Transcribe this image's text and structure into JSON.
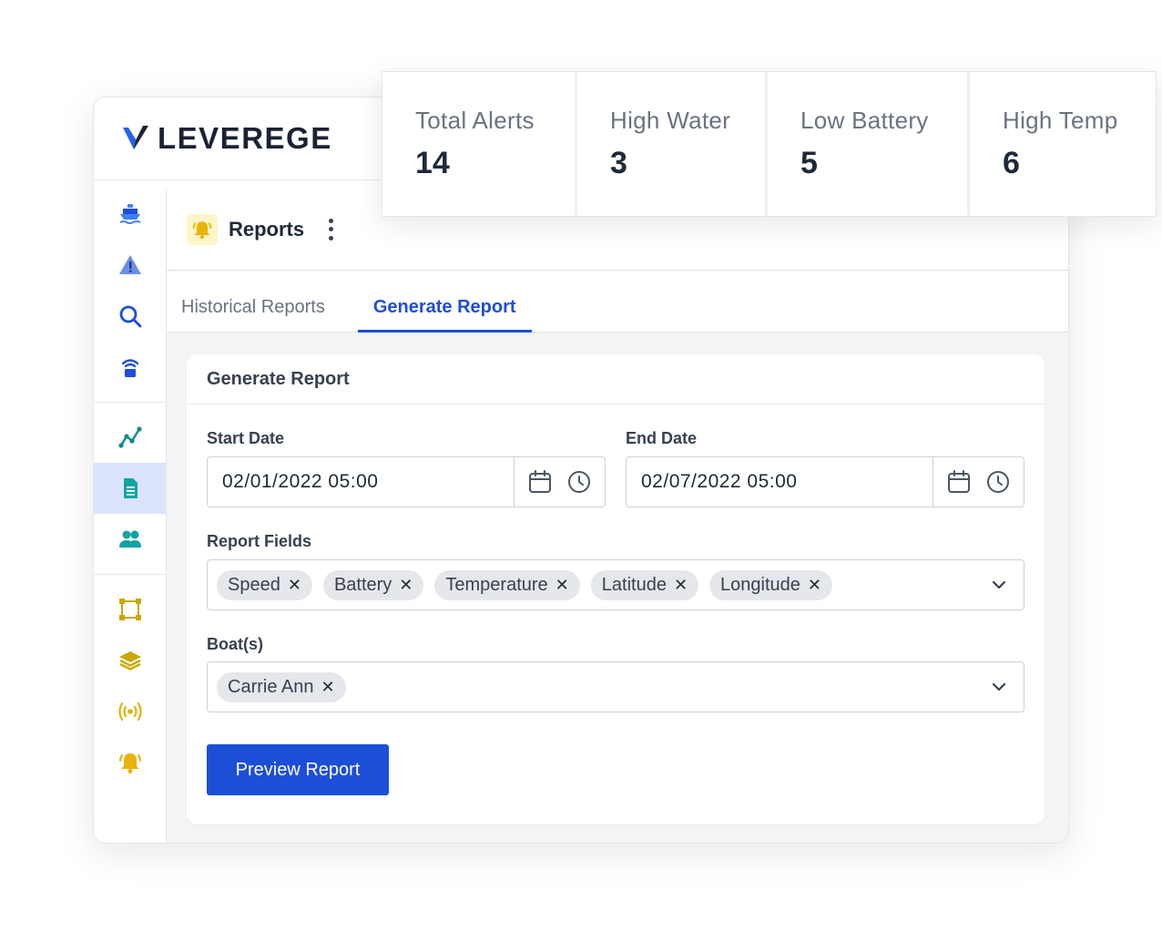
{
  "brand": {
    "name": "LEVEREGE"
  },
  "colors": {
    "accent": "#1d4ed8",
    "sidebar_active": "#dbe4fb",
    "yellow_icon": "#eab308",
    "teal_icon": "#14a3a3"
  },
  "sidebar": {
    "items": [
      {
        "icon": "boat-icon"
      },
      {
        "icon": "alert-icon"
      },
      {
        "icon": "search-icon"
      },
      {
        "icon": "sensor-icon"
      },
      {
        "icon": "analytics-icon"
      },
      {
        "icon": "reports-icon",
        "active": true
      },
      {
        "icon": "users-icon"
      },
      {
        "icon": "geofence-icon"
      },
      {
        "icon": "layers-icon"
      },
      {
        "icon": "broadcast-icon"
      },
      {
        "icon": "bell-icon"
      }
    ]
  },
  "header": {
    "title": "Reports",
    "icon": "bell-icon"
  },
  "tabs": [
    {
      "label": "Historical Reports",
      "active": false
    },
    {
      "label": "Generate Report",
      "active": true
    }
  ],
  "form": {
    "title": "Generate Report",
    "start_date": {
      "label": "Start Date",
      "value": "02/01/2022 05:00"
    },
    "end_date": {
      "label": "End Date",
      "value": "02/07/2022 05:00"
    },
    "report_fields": {
      "label": "Report Fields",
      "chips": [
        "Speed",
        "Battery",
        "Temperature",
        "Latitude",
        "Longitude"
      ]
    },
    "boats": {
      "label": "Boat(s)",
      "chips": [
        "Carrie Ann"
      ]
    },
    "preview_label": "Preview Report"
  },
  "stats": [
    {
      "label": "Total Alerts",
      "value": "14"
    },
    {
      "label": "High Water",
      "value": "3"
    },
    {
      "label": "Low Battery",
      "value": "5"
    },
    {
      "label": "High Temp",
      "value": "6"
    }
  ]
}
